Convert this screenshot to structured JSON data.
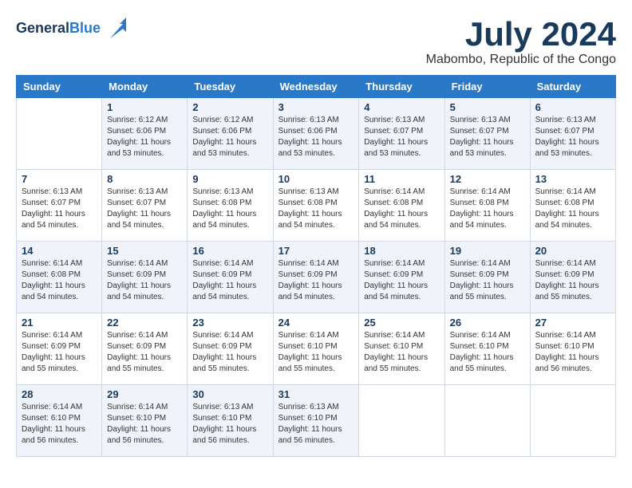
{
  "header": {
    "logo_line1": "General",
    "logo_line2": "Blue",
    "month_title": "July 2024",
    "location": "Mabombo, Republic of the Congo"
  },
  "weekdays": [
    "Sunday",
    "Monday",
    "Tuesday",
    "Wednesday",
    "Thursday",
    "Friday",
    "Saturday"
  ],
  "weeks": [
    [
      {
        "day": "",
        "info": ""
      },
      {
        "day": "1",
        "info": "Sunrise: 6:12 AM\nSunset: 6:06 PM\nDaylight: 11 hours\nand 53 minutes."
      },
      {
        "day": "2",
        "info": "Sunrise: 6:12 AM\nSunset: 6:06 PM\nDaylight: 11 hours\nand 53 minutes."
      },
      {
        "day": "3",
        "info": "Sunrise: 6:13 AM\nSunset: 6:06 PM\nDaylight: 11 hours\nand 53 minutes."
      },
      {
        "day": "4",
        "info": "Sunrise: 6:13 AM\nSunset: 6:07 PM\nDaylight: 11 hours\nand 53 minutes."
      },
      {
        "day": "5",
        "info": "Sunrise: 6:13 AM\nSunset: 6:07 PM\nDaylight: 11 hours\nand 53 minutes."
      },
      {
        "day": "6",
        "info": "Sunrise: 6:13 AM\nSunset: 6:07 PM\nDaylight: 11 hours\nand 53 minutes."
      }
    ],
    [
      {
        "day": "7",
        "info": "Sunrise: 6:13 AM\nSunset: 6:07 PM\nDaylight: 11 hours\nand 54 minutes."
      },
      {
        "day": "8",
        "info": "Sunrise: 6:13 AM\nSunset: 6:07 PM\nDaylight: 11 hours\nand 54 minutes."
      },
      {
        "day": "9",
        "info": "Sunrise: 6:13 AM\nSunset: 6:08 PM\nDaylight: 11 hours\nand 54 minutes."
      },
      {
        "day": "10",
        "info": "Sunrise: 6:13 AM\nSunset: 6:08 PM\nDaylight: 11 hours\nand 54 minutes."
      },
      {
        "day": "11",
        "info": "Sunrise: 6:14 AM\nSunset: 6:08 PM\nDaylight: 11 hours\nand 54 minutes."
      },
      {
        "day": "12",
        "info": "Sunrise: 6:14 AM\nSunset: 6:08 PM\nDaylight: 11 hours\nand 54 minutes."
      },
      {
        "day": "13",
        "info": "Sunrise: 6:14 AM\nSunset: 6:08 PM\nDaylight: 11 hours\nand 54 minutes."
      }
    ],
    [
      {
        "day": "14",
        "info": "Sunrise: 6:14 AM\nSunset: 6:08 PM\nDaylight: 11 hours\nand 54 minutes."
      },
      {
        "day": "15",
        "info": "Sunrise: 6:14 AM\nSunset: 6:09 PM\nDaylight: 11 hours\nand 54 minutes."
      },
      {
        "day": "16",
        "info": "Sunrise: 6:14 AM\nSunset: 6:09 PM\nDaylight: 11 hours\nand 54 minutes."
      },
      {
        "day": "17",
        "info": "Sunrise: 6:14 AM\nSunset: 6:09 PM\nDaylight: 11 hours\nand 54 minutes."
      },
      {
        "day": "18",
        "info": "Sunrise: 6:14 AM\nSunset: 6:09 PM\nDaylight: 11 hours\nand 54 minutes."
      },
      {
        "day": "19",
        "info": "Sunrise: 6:14 AM\nSunset: 6:09 PM\nDaylight: 11 hours\nand 55 minutes."
      },
      {
        "day": "20",
        "info": "Sunrise: 6:14 AM\nSunset: 6:09 PM\nDaylight: 11 hours\nand 55 minutes."
      }
    ],
    [
      {
        "day": "21",
        "info": "Sunrise: 6:14 AM\nSunset: 6:09 PM\nDaylight: 11 hours\nand 55 minutes."
      },
      {
        "day": "22",
        "info": "Sunrise: 6:14 AM\nSunset: 6:09 PM\nDaylight: 11 hours\nand 55 minutes."
      },
      {
        "day": "23",
        "info": "Sunrise: 6:14 AM\nSunset: 6:09 PM\nDaylight: 11 hours\nand 55 minutes."
      },
      {
        "day": "24",
        "info": "Sunrise: 6:14 AM\nSunset: 6:10 PM\nDaylight: 11 hours\nand 55 minutes."
      },
      {
        "day": "25",
        "info": "Sunrise: 6:14 AM\nSunset: 6:10 PM\nDaylight: 11 hours\nand 55 minutes."
      },
      {
        "day": "26",
        "info": "Sunrise: 6:14 AM\nSunset: 6:10 PM\nDaylight: 11 hours\nand 55 minutes."
      },
      {
        "day": "27",
        "info": "Sunrise: 6:14 AM\nSunset: 6:10 PM\nDaylight: 11 hours\nand 56 minutes."
      }
    ],
    [
      {
        "day": "28",
        "info": "Sunrise: 6:14 AM\nSunset: 6:10 PM\nDaylight: 11 hours\nand 56 minutes."
      },
      {
        "day": "29",
        "info": "Sunrise: 6:14 AM\nSunset: 6:10 PM\nDaylight: 11 hours\nand 56 minutes."
      },
      {
        "day": "30",
        "info": "Sunrise: 6:13 AM\nSunset: 6:10 PM\nDaylight: 11 hours\nand 56 minutes."
      },
      {
        "day": "31",
        "info": "Sunrise: 6:13 AM\nSunset: 6:10 PM\nDaylight: 11 hours\nand 56 minutes."
      },
      {
        "day": "",
        "info": ""
      },
      {
        "day": "",
        "info": ""
      },
      {
        "day": "",
        "info": ""
      }
    ]
  ]
}
